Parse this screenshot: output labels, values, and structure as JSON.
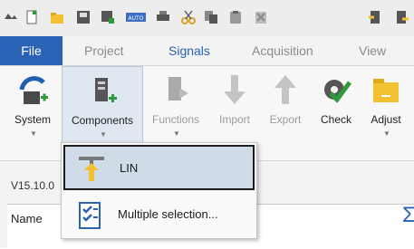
{
  "tabs": [
    "File",
    "Project",
    "Signals",
    "Acquisition",
    "View"
  ],
  "ribbon": {
    "system": "System",
    "components": "Components",
    "functions": "Functions",
    "import": "Import",
    "export": "Export",
    "check": "Check",
    "adjust": "Adjust"
  },
  "version": "V15.10.0",
  "grid": {
    "name_header": "Name",
    "sigma": "Σ"
  },
  "menu": {
    "items": [
      "LIN",
      "Multiple selection..."
    ]
  },
  "colors": {
    "accent": "#2a63b5",
    "menu_highlight": "#d0dbe8"
  }
}
